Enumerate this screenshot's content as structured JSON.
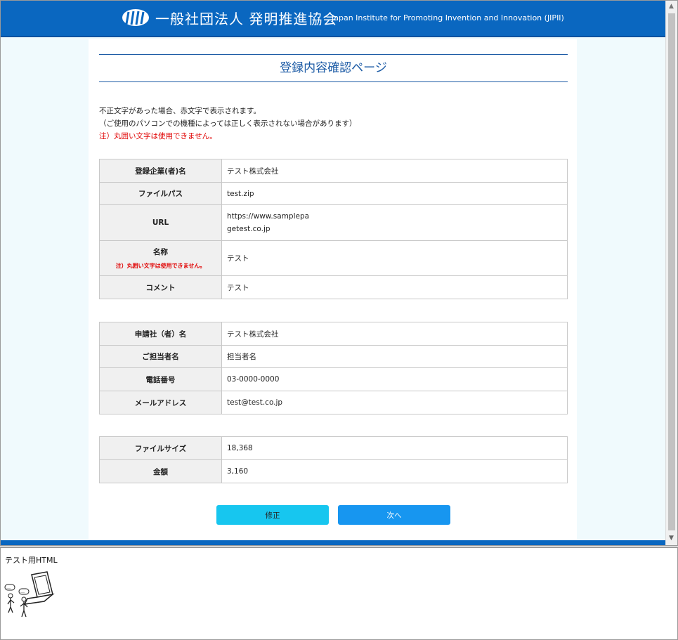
{
  "header": {
    "org_name_jp": "一般社団法人 発明推進協会",
    "org_name_en": "Japan Institute for Promoting Invention and Innovation (JIPII)",
    "logo_icon": "jiii-logo-icon",
    "bg_color": "#0a67c0"
  },
  "page": {
    "title": "登録内容確認ページ",
    "notes": [
      "不正文字があった場合、赤文字で表示されます。",
      "（ご使用のパソコンでの機種によっては正しく表示されない場合があります）",
      "注）丸囲い文字は使用できません。"
    ]
  },
  "registration": {
    "company_label": "登録企業(者)名",
    "company_value": "テスト株式会社",
    "filepath_label": "ファイルパス",
    "filepath_value": "test.zip",
    "url_label": "URL",
    "url_value_line1": "https://www.samplepa",
    "url_value_line2": "getest.co.jp",
    "name_label": "名称",
    "name_note": "注）丸囲い文字は使用できません。",
    "name_value": "テスト",
    "comment_label": "コメント",
    "comment_value": "テスト"
  },
  "applicant": {
    "company_label": "申請社（者）名",
    "company_value": "テスト株式会社",
    "person_label": "ご担当者名",
    "person_value": "担当者名",
    "phone_label": "電話番号",
    "phone_value": "03-0000-0000",
    "email_label": "メールアドレス",
    "email_value": "test@test.co.jp"
  },
  "fee": {
    "filesize_label": "ファイルサイズ",
    "filesize_value": "18,368",
    "amount_label": "金額",
    "amount_value": "3,160"
  },
  "buttons": {
    "edit_label": "修正",
    "next_label": "次へ",
    "edit_color": "#17c6ef",
    "next_color": "#1796f0"
  },
  "bottom_frame": {
    "label": "テスト用HTML",
    "illustration_icon": "people-laptop-illustration-icon"
  }
}
